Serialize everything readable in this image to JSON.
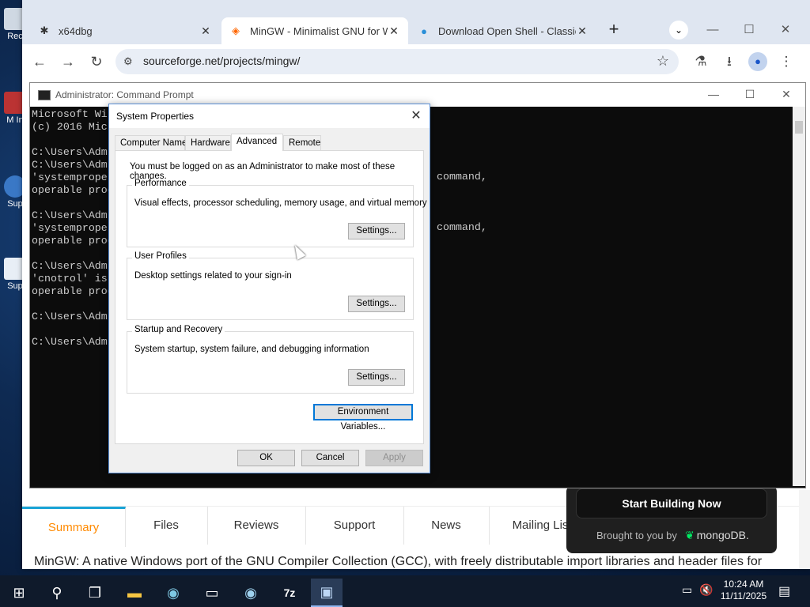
{
  "desktop": {
    "icons": [
      {
        "label": "Rec"
      },
      {
        "label": "M In"
      },
      {
        "label": "Sup"
      },
      {
        "label": "Sup"
      }
    ]
  },
  "browser": {
    "tabs": [
      {
        "title": "x64dbg",
        "icon": "bug-icon"
      },
      {
        "title": "MinGW - Minimalist GNU for W",
        "icon": "sourceforge-icon"
      },
      {
        "title": "Download Open Shell - Classic",
        "icon": "globe-icon"
      }
    ],
    "url": "sourceforge.net/projects/mingw/",
    "colors": {
      "accent": "#1a73e8",
      "tabstrip": "#dfe6f1"
    }
  },
  "page": {
    "nav": [
      {
        "label": "Summary",
        "active": true
      },
      {
        "label": "Files"
      },
      {
        "label": "Reviews"
      },
      {
        "label": "Support"
      },
      {
        "label": "News"
      },
      {
        "label": "Mailing Lis"
      }
    ],
    "description": "MinGW: A native Windows port of the GNU Compiler Collection (GCC), with freely distributable import libraries and header files for",
    "ad": {
      "cta": "Start Building Now",
      "brought_by": "Brought to you by",
      "brand": "mongoDB."
    },
    "colors": {
      "active_tab": "#ff8a00",
      "active_border": "#19a3d6"
    }
  },
  "cmd": {
    "title": "Administrator: Command Prompt",
    "lines": [
      "Microsoft Wi",
      "(c) 2016 Mic",
      "",
      "C:\\Users\\Adm",
      "C:\\Users\\Adm",
      "'systemproper",
      "operable prog",
      "",
      "C:\\Users\\Adm",
      "'systemproper",
      "operable prog",
      "",
      "C:\\Users\\Adm",
      "'cnotrol' is",
      "operable prog",
      "",
      "C:\\Users\\Adm",
      "",
      "C:\\Users\\Adm"
    ],
    "right_lines": [
      "command,",
      "",
      "",
      "",
      "command,"
    ]
  },
  "system_properties": {
    "title": "System Properties",
    "tabs": [
      "Computer Name",
      "Hardware",
      "Advanced",
      "Remote"
    ],
    "active_tab": "Advanced",
    "note": "You must be logged on as an Administrator to make most of these changes.",
    "groups": [
      {
        "title": "Performance",
        "desc": "Visual effects, processor scheduling, memory usage, and virtual memory",
        "button": "Settings..."
      },
      {
        "title": "User Profiles",
        "desc": "Desktop settings related to your sign-in",
        "button": "Settings..."
      },
      {
        "title": "Startup and Recovery",
        "desc": "System startup, system failure, and debugging information",
        "button": "Settings..."
      }
    ],
    "env_button": "Environment Variables...",
    "ok": "OK",
    "cancel": "Cancel",
    "apply": "Apply"
  },
  "taskbar": {
    "time": "10:24 AM",
    "date": "11/11/2025"
  }
}
